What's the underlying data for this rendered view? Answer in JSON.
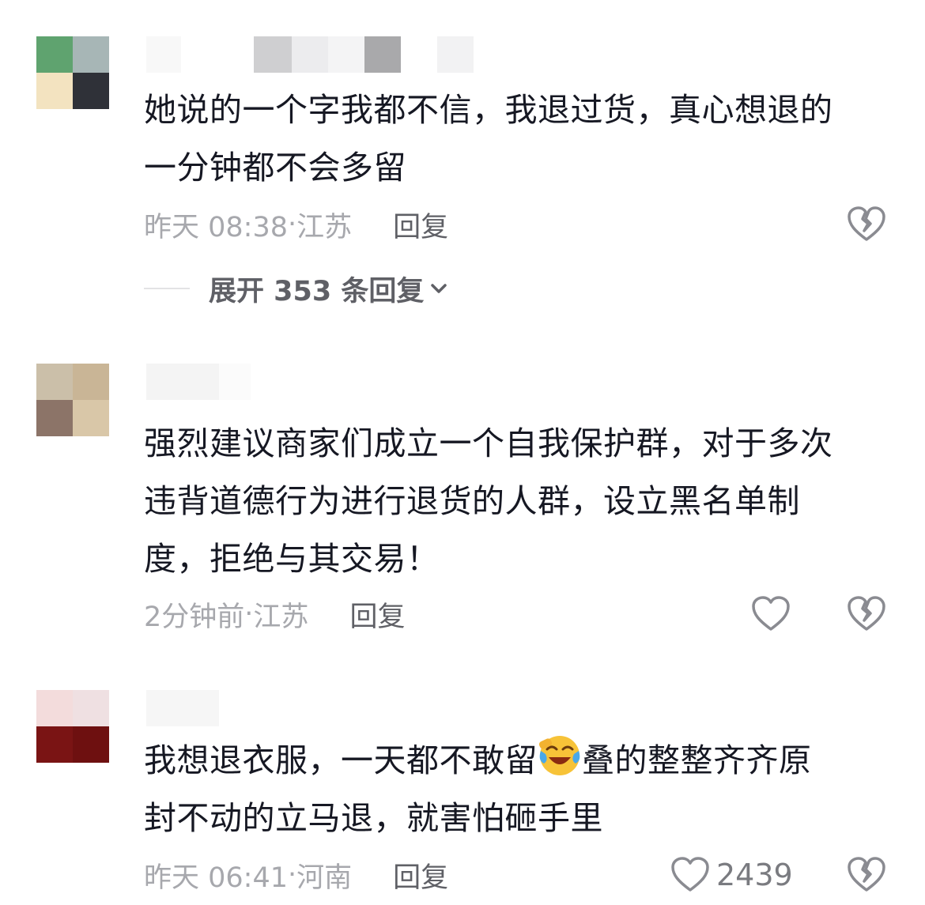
{
  "comments": [
    {
      "text": "她说的一个字我都不信，我退过货，真心想退的\n一分钟都不会多留",
      "time": "昨天 08:38",
      "sep": "·",
      "location": "江苏",
      "reply_label": "回复",
      "expand_label": "展开 353 条回复"
    },
    {
      "text": "强烈建议商家们成立一个自我保护群，对于多次\n违背道德行为进行退货的人群，设立黑名单制\n度，拒绝与其交易！",
      "time": "2分钟前",
      "sep": " · ",
      "location": "江苏",
      "reply_label": "回复"
    },
    {
      "text_before_emoji": "我想退衣服，一天都不敢留",
      "emoji": "crying-laughing-emoji",
      "text_after_emoji": "叠的整整齐齐原\n封不动的立马退，就害怕砸手里",
      "time": "昨天 06:41",
      "sep": "·",
      "location": "河南",
      "reply_label": "回复",
      "like_count": "2439"
    }
  ],
  "colors": {
    "text": "#161823",
    "meta": "#a7a8ad",
    "reply": "#5f6066",
    "icon": "#8a8b91"
  },
  "icons": [
    "broken-heart-icon",
    "heart-icon",
    "chevron-down-icon"
  ]
}
